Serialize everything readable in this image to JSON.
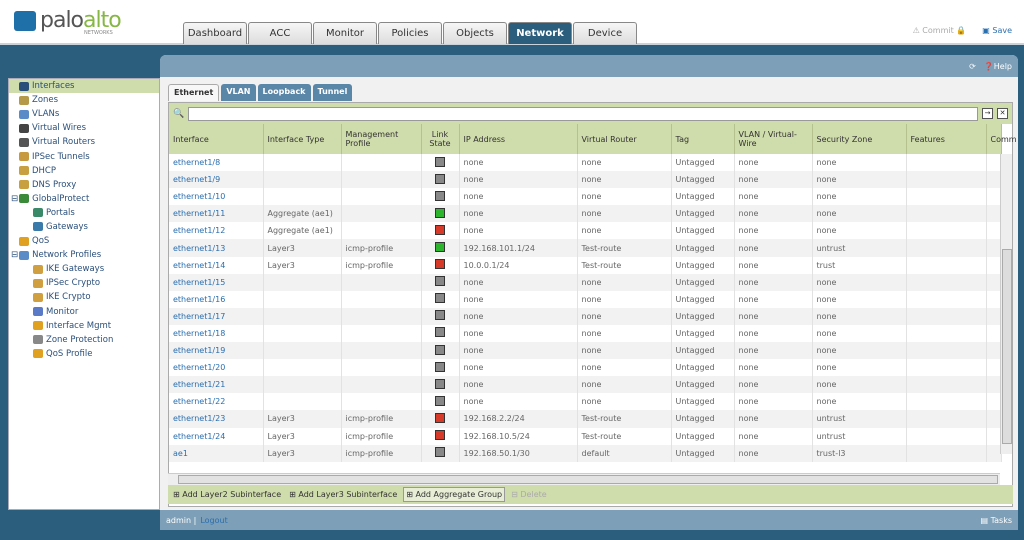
{
  "brand": {
    "name_a": "palo",
    "name_b": "alto",
    "sub": "NETWORKS"
  },
  "nav": {
    "tabs": [
      "Dashboard",
      "ACC",
      "Monitor",
      "Policies",
      "Objects",
      "Network",
      "Device"
    ],
    "active": "Network"
  },
  "topright": {
    "commit": "Commit",
    "save": "Save"
  },
  "panel": {
    "help": "Help"
  },
  "sidebar": {
    "items": [
      {
        "label": "Interfaces",
        "indent": 0,
        "selected": true,
        "color": "#2a4f7a"
      },
      {
        "label": "Zones",
        "indent": 0,
        "color": "#b59a4a"
      },
      {
        "label": "VLANs",
        "indent": 0,
        "color": "#5a8cc8"
      },
      {
        "label": "Virtual Wires",
        "indent": 0,
        "color": "#444"
      },
      {
        "label": "Virtual Routers",
        "indent": 0,
        "color": "#555"
      },
      {
        "label": "IPSec Tunnels",
        "indent": 0,
        "color": "#c89a40"
      },
      {
        "label": "DHCP",
        "indent": 0,
        "color": "#c8a040"
      },
      {
        "label": "DNS Proxy",
        "indent": 0,
        "color": "#c8a040"
      },
      {
        "label": "GlobalProtect",
        "indent": 0,
        "expander": "-",
        "color": "#3a8a3a"
      },
      {
        "label": "Portals",
        "indent": 1,
        "color": "#3a8a6a"
      },
      {
        "label": "Gateways",
        "indent": 1,
        "color": "#3a7aaa"
      },
      {
        "label": "QoS",
        "indent": 0,
        "color": "#e0a020"
      },
      {
        "label": "Network Profiles",
        "indent": 0,
        "expander": "-",
        "color": "#5a8cc8"
      },
      {
        "label": "IKE Gateways",
        "indent": 1,
        "color": "#d0a040"
      },
      {
        "label": "IPSec Crypto",
        "indent": 1,
        "color": "#d0a040"
      },
      {
        "label": "IKE Crypto",
        "indent": 1,
        "color": "#d0a040"
      },
      {
        "label": "Monitor",
        "indent": 1,
        "color": "#5a7ac8"
      },
      {
        "label": "Interface Mgmt",
        "indent": 1,
        "color": "#e0a020"
      },
      {
        "label": "Zone Protection",
        "indent": 1,
        "color": "#888"
      },
      {
        "label": "QoS Profile",
        "indent": 1,
        "color": "#e0a020"
      }
    ]
  },
  "subtabs": {
    "items": [
      "Ethernet",
      "VLAN",
      "Loopback",
      "Tunnel"
    ],
    "active": "Ethernet"
  },
  "search": {
    "value": ""
  },
  "table": {
    "columns": [
      "Interface",
      "Interface Type",
      "Management Profile",
      "Link State",
      "IP Address",
      "Virtual Router",
      "Tag",
      "VLAN / Virtual-Wire",
      "Security Zone",
      "Features",
      "Comm"
    ],
    "link_colors": {
      "up": "#2db52d",
      "down": "#d83a2a",
      "unknown": "#888888"
    },
    "rows": [
      [
        "ethernet1/8",
        "",
        "",
        "unknown",
        "none",
        "none",
        "Untagged",
        "none",
        "none"
      ],
      [
        "ethernet1/9",
        "",
        "",
        "unknown",
        "none",
        "none",
        "Untagged",
        "none",
        "none"
      ],
      [
        "ethernet1/10",
        "",
        "",
        "unknown",
        "none",
        "none",
        "Untagged",
        "none",
        "none"
      ],
      [
        "ethernet1/11",
        "Aggregate (ae1)",
        "",
        "up",
        "none",
        "none",
        "Untagged",
        "none",
        "none"
      ],
      [
        "ethernet1/12",
        "Aggregate (ae1)",
        "",
        "down",
        "none",
        "none",
        "Untagged",
        "none",
        "none"
      ],
      [
        "ethernet1/13",
        "Layer3",
        "icmp-profile",
        "up",
        "192.168.101.1/24",
        "Test-route",
        "Untagged",
        "none",
        "untrust"
      ],
      [
        "ethernet1/14",
        "Layer3",
        "icmp-profile",
        "down",
        "10.0.0.1/24",
        "Test-route",
        "Untagged",
        "none",
        "trust"
      ],
      [
        "ethernet1/15",
        "",
        "",
        "unknown",
        "none",
        "none",
        "Untagged",
        "none",
        "none"
      ],
      [
        "ethernet1/16",
        "",
        "",
        "unknown",
        "none",
        "none",
        "Untagged",
        "none",
        "none"
      ],
      [
        "ethernet1/17",
        "",
        "",
        "unknown",
        "none",
        "none",
        "Untagged",
        "none",
        "none"
      ],
      [
        "ethernet1/18",
        "",
        "",
        "unknown",
        "none",
        "none",
        "Untagged",
        "none",
        "none"
      ],
      [
        "ethernet1/19",
        "",
        "",
        "unknown",
        "none",
        "none",
        "Untagged",
        "none",
        "none"
      ],
      [
        "ethernet1/20",
        "",
        "",
        "unknown",
        "none",
        "none",
        "Untagged",
        "none",
        "none"
      ],
      [
        "ethernet1/21",
        "",
        "",
        "unknown",
        "none",
        "none",
        "Untagged",
        "none",
        "none"
      ],
      [
        "ethernet1/22",
        "",
        "",
        "unknown",
        "none",
        "none",
        "Untagged",
        "none",
        "none"
      ],
      [
        "ethernet1/23",
        "Layer3",
        "icmp-profile",
        "down",
        "192.168.2.2/24",
        "Test-route",
        "Untagged",
        "none",
        "untrust"
      ],
      [
        "ethernet1/24",
        "Layer3",
        "icmp-profile",
        "down",
        "192.168.10.5/24",
        "Test-route",
        "Untagged",
        "none",
        "untrust"
      ],
      [
        "ae1",
        "Layer3",
        "icmp-profile",
        "unknown",
        "192.168.50.1/30",
        "default",
        "Untagged",
        "none",
        "trust-l3"
      ]
    ]
  },
  "toolbar": {
    "add_l2": "Add Layer2 Subinterface",
    "add_l3": "Add Layer3 Subinterface",
    "add_agg": "Add Aggregate Group",
    "delete": "Delete"
  },
  "footer": {
    "user": "admin",
    "logout": "Logout",
    "tasks": "Tasks"
  }
}
